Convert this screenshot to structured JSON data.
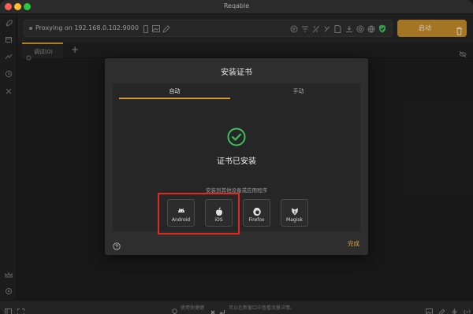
{
  "window": {
    "title": "Reqable"
  },
  "toolbar": {
    "proxy_text": "Proxying on 192.168.0.102:9000",
    "start_label": "启动"
  },
  "tabs": [
    {
      "label": "调试(0)"
    }
  ],
  "statusbar": {
    "shortcut_text": "使用快捷键",
    "hint_text": "可以在新窗口中查看流量详情。"
  },
  "modal": {
    "title": "安装证书",
    "tabs": [
      {
        "label": "自动"
      },
      {
        "label": "手动"
      }
    ],
    "status": "证书已安装",
    "other_label": "安装到其他设备或应用程序",
    "platforms": [
      {
        "label": "Android",
        "icon": "android-icon"
      },
      {
        "label": "iOS",
        "icon": "apple-icon"
      },
      {
        "label": "Firefox",
        "icon": "firefox-icon"
      },
      {
        "label": "Magisk",
        "icon": "magisk-icon"
      }
    ],
    "done_label": "完成"
  },
  "colors": {
    "accent": "#d29a32",
    "success": "#3fbf5f",
    "highlight": "#e02a1f"
  }
}
